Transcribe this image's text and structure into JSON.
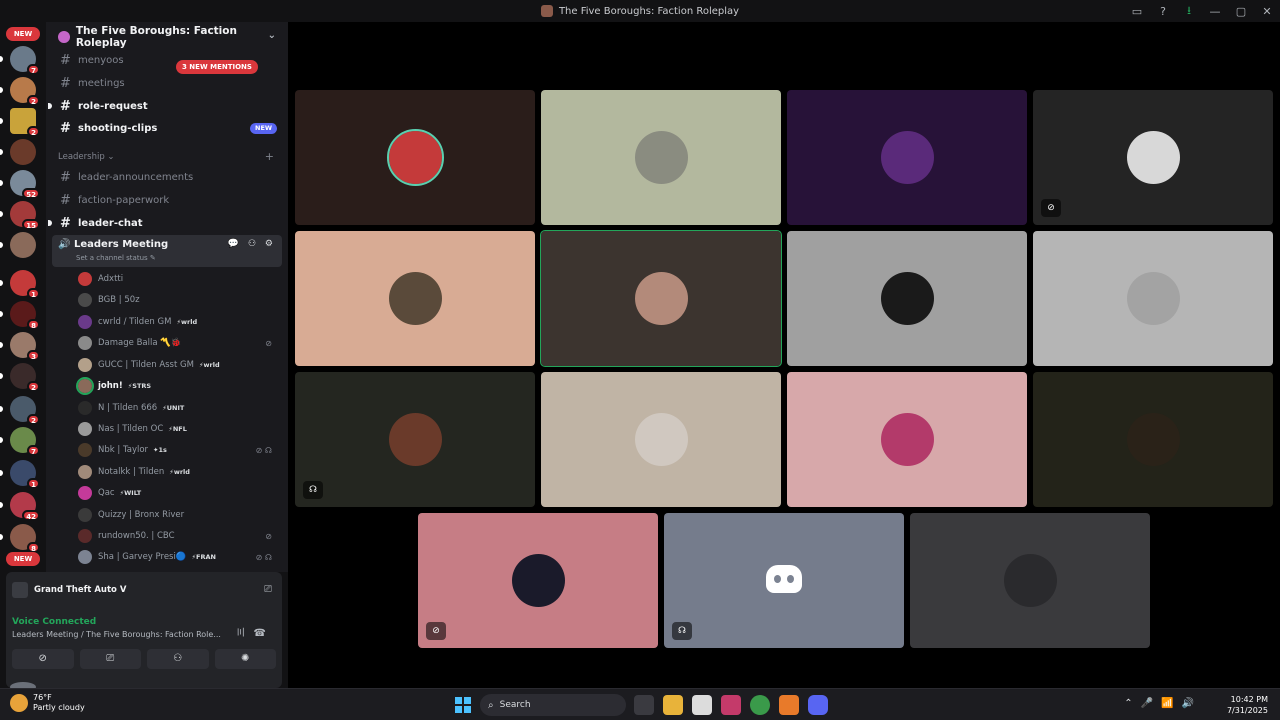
{
  "window": {
    "title": "The Five Boroughs: Faction Roleplay"
  },
  "server_list": {
    "new_label": "NEW",
    "badges": [
      "7",
      "2",
      "2",
      "52",
      "15",
      "1",
      "8",
      "3",
      "2",
      "2",
      "7",
      "1",
      "42",
      "8"
    ]
  },
  "server": {
    "name": "The Five Boroughs: Faction Roleplay"
  },
  "channels": [
    {
      "name": "menyoos"
    },
    {
      "name": "meetings"
    },
    {
      "name": "role-request"
    },
    {
      "name": "shooting-clips"
    }
  ],
  "mentions_pill": "3 NEW MENTIONS",
  "new_tag": "NEW",
  "category": {
    "name": "Leadership ⌄",
    "add": "+"
  },
  "leadership_channels": [
    {
      "name": "leader-announcements"
    },
    {
      "name": "faction-paperwork"
    },
    {
      "name": "leader-chat"
    }
  ],
  "voice_channel": {
    "name": "Leaders Meeting",
    "status": "Set a channel status ✎",
    "icons": "💬 ⚇ ⚙"
  },
  "members": [
    {
      "name": "Adxtti",
      "tag": ""
    },
    {
      "name": "BGB | 50z",
      "tag": ""
    },
    {
      "name": "cwrld / Tilden GM",
      "tag": "⚡wrld"
    },
    {
      "name": "Damage Balla 〽️🐞",
      "tag": ""
    },
    {
      "name": "GUCC | Tilden Asst GM",
      "tag": "⚡wrld"
    },
    {
      "name": "john!",
      "tag": "⚡STRS"
    },
    {
      "name": "N | Tilden 666",
      "tag": "⚡UNIT"
    },
    {
      "name": "Nas | Tilden OC",
      "tag": "⚡NFL"
    },
    {
      "name": "Nbk | Taylor",
      "tag": "✦1s"
    },
    {
      "name": "Notalkk | Tilden",
      "tag": "⚡wrld"
    },
    {
      "name": "Qac",
      "tag": "⚡WILT"
    },
    {
      "name": "Quizzy | Bronx River",
      "tag": ""
    },
    {
      "name": "rundown50. | CBC",
      "tag": ""
    },
    {
      "name": "Sha | Garvey Presi🔵",
      "tag": "⚡FRAN"
    }
  ],
  "panel": {
    "game": "Grand Theft Auto V",
    "voice_status": "Voice Connected",
    "voice_location": "Leaders Meeting / The Five Boroughs: Faction Role..."
  },
  "taskbar": {
    "temp": "76°F",
    "weather": "Partly cloudy",
    "search_label": "Search",
    "time": "10:42 PM",
    "date": "7/31/2025"
  },
  "colors": {
    "accent": "#5865f2",
    "danger": "#da373c",
    "online": "#23a55a"
  },
  "tile_colors": [
    "#2a1d1a",
    "#b3b89e",
    "#271238",
    "#242424",
    "#d8ab94",
    "#3c342f",
    "#a0a0a0",
    "#b5b5b5",
    "#242620",
    "#c0b4a5",
    "#d7a8aa",
    "#232319",
    "#c67d85",
    "#757c8c",
    "#3a3a3d"
  ]
}
